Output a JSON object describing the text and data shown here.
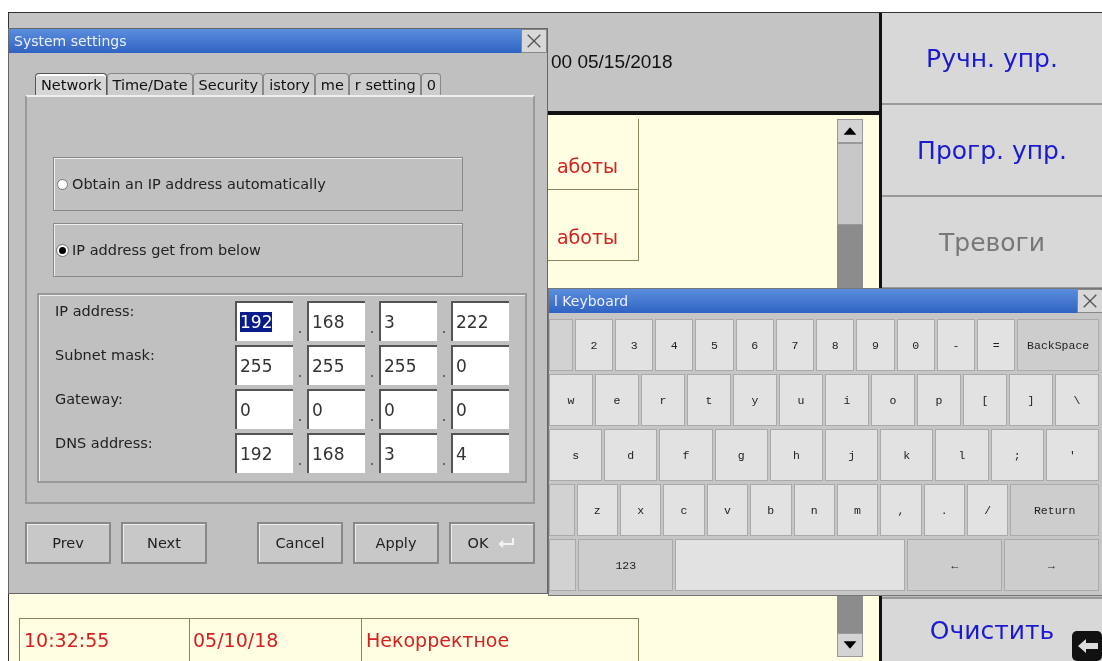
{
  "header": {
    "datetime": "00 05/15/2018"
  },
  "event_table": {
    "top_rows": [
      {
        "column_3": "аботы"
      },
      {
        "column_3": "аботы"
      }
    ],
    "bottom_rows": [
      {
        "time": "10:32:55",
        "date": "05/10/18",
        "message": "Некорректное"
      }
    ]
  },
  "side_buttons": [
    {
      "label": "Ручн. упр.",
      "disabled": false
    },
    {
      "label": "Прогр. упр.",
      "disabled": false
    },
    {
      "label": "Тревоги",
      "disabled": true
    },
    {
      "label": "Очистить",
      "disabled": false
    }
  ],
  "settings_dialog": {
    "title": "System settings",
    "tabs": [
      {
        "label": "Network",
        "selected": true
      },
      {
        "label": "Time/Date",
        "selected": false
      },
      {
        "label": "Security",
        "selected": false
      },
      {
        "label": "istory",
        "selected": false
      },
      {
        "label": "me",
        "selected": false
      },
      {
        "label": "r setting",
        "selected": false
      },
      {
        "label": "0",
        "selected": false
      }
    ],
    "ip_mode": [
      {
        "label": "Obtain an IP address automatically",
        "selected": false
      },
      {
        "label": "IP address get from below",
        "selected": true
      }
    ],
    "addresses": [
      {
        "label": "IP address:",
        "octets": [
          {
            "value": "192",
            "selected": true
          },
          {
            "value": "168",
            "selected": false
          },
          {
            "value": "3",
            "selected": false
          },
          {
            "value": "222",
            "selected": false
          }
        ]
      },
      {
        "label": "Subnet mask:",
        "octets": [
          {
            "value": "255",
            "selected": false
          },
          {
            "value": "255",
            "selected": false
          },
          {
            "value": "255",
            "selected": false
          },
          {
            "value": "0",
            "selected": false
          }
        ]
      },
      {
        "label": "Gateway:",
        "octets": [
          {
            "value": "0",
            "selected": false
          },
          {
            "value": "0",
            "selected": false
          },
          {
            "value": "0",
            "selected": false
          },
          {
            "value": "0",
            "selected": false
          }
        ]
      },
      {
        "label": "DNS address:",
        "octets": [
          {
            "value": "192",
            "selected": false
          },
          {
            "value": "168",
            "selected": false
          },
          {
            "value": "3",
            "selected": false
          },
          {
            "value": "4",
            "selected": false
          }
        ]
      }
    ],
    "nav_buttons": [
      "Prev",
      "Next"
    ],
    "action_buttons": [
      {
        "label": "Cancel",
        "kind": "plain"
      },
      {
        "label": "Apply",
        "kind": "plain"
      },
      {
        "label": "OK",
        "kind": "enter"
      }
    ]
  },
  "keyboard": {
    "title": "l Keyboard",
    "rows": [
      {
        "keys": [
          {
            "kind": "stub"
          },
          {
            "kind": "key",
            "label": "2"
          },
          {
            "kind": "key",
            "label": "3"
          },
          {
            "kind": "key",
            "label": "4"
          },
          {
            "kind": "key",
            "label": "5"
          },
          {
            "kind": "key",
            "label": "6"
          },
          {
            "kind": "key",
            "label": "7"
          },
          {
            "kind": "key",
            "label": "8"
          },
          {
            "kind": "key",
            "label": "9"
          },
          {
            "kind": "key",
            "label": "0"
          },
          {
            "kind": "key",
            "label": "-"
          },
          {
            "kind": "key",
            "label": "="
          },
          {
            "kind": "function",
            "label": "BackSpace"
          }
        ]
      },
      {
        "keys": [
          {
            "kind": "key",
            "label": "w"
          },
          {
            "kind": "key",
            "label": "e"
          },
          {
            "kind": "key",
            "label": "r"
          },
          {
            "kind": "key",
            "label": "t"
          },
          {
            "kind": "key",
            "label": "y"
          },
          {
            "kind": "key",
            "label": "u"
          },
          {
            "kind": "key",
            "label": "i"
          },
          {
            "kind": "key",
            "label": "o"
          },
          {
            "kind": "key",
            "label": "p"
          },
          {
            "kind": "key",
            "label": "["
          },
          {
            "kind": "key",
            "label": "]"
          },
          {
            "kind": "key",
            "label": "\\"
          }
        ]
      },
      {
        "keys": [
          {
            "kind": "key",
            "label": "s"
          },
          {
            "kind": "key",
            "label": "d"
          },
          {
            "kind": "key",
            "label": "f"
          },
          {
            "kind": "key",
            "label": "g"
          },
          {
            "kind": "key",
            "label": "h"
          },
          {
            "kind": "key",
            "label": "j"
          },
          {
            "kind": "key",
            "label": "k"
          },
          {
            "kind": "key",
            "label": "l"
          },
          {
            "kind": "key",
            "label": ";"
          },
          {
            "kind": "key",
            "label": "'"
          }
        ]
      },
      {
        "keys": [
          {
            "kind": "stub"
          },
          {
            "kind": "key",
            "label": "z"
          },
          {
            "kind": "key",
            "label": "x"
          },
          {
            "kind": "key",
            "label": "c"
          },
          {
            "kind": "key",
            "label": "v"
          },
          {
            "kind": "key",
            "label": "b"
          },
          {
            "kind": "key",
            "label": "n"
          },
          {
            "kind": "key",
            "label": "m"
          },
          {
            "kind": "key",
            "label": ","
          },
          {
            "kind": "key",
            "label": "."
          },
          {
            "kind": "key",
            "label": "/"
          },
          {
            "kind": "function",
            "label": "Return"
          }
        ]
      },
      {
        "keys": [
          {
            "kind": "stub"
          },
          {
            "kind": "function",
            "label": "123"
          },
          {
            "kind": "space"
          },
          {
            "kind": "function",
            "label": "←"
          },
          {
            "kind": "function",
            "label": "→"
          }
        ]
      }
    ]
  }
}
